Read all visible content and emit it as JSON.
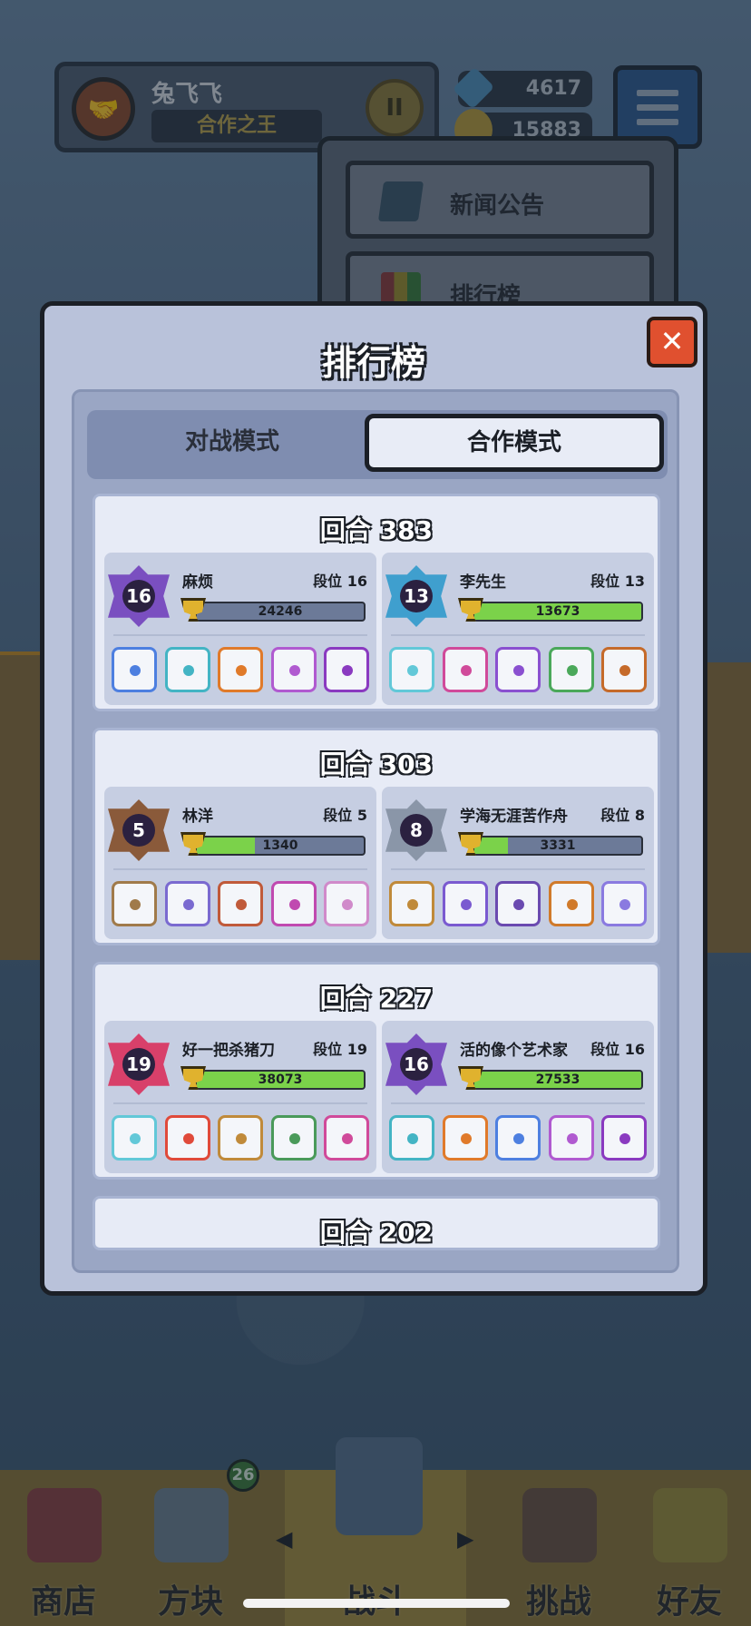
{
  "header": {
    "player_name": "兔飞飞",
    "player_title": "合作之王",
    "rank_badge_text": "II",
    "gems": "4617",
    "gold": "15883"
  },
  "dropdown": {
    "news_label": "新闻公告",
    "leaderboard_label": "排行榜"
  },
  "modal": {
    "title": "排行榜",
    "close_glyph": "✕",
    "tabs": {
      "battle": "对战模式",
      "coop": "合作模式"
    },
    "matches": [
      {
        "round": "回合 383",
        "players": [
          {
            "name": "麻烦",
            "tier_label": "段位 16",
            "badge": "16",
            "trophies": "24246",
            "progress": 0.0,
            "badge_color": "#7a4fc0",
            "dice_colors": [
              "#4d7fe0",
              "#43b4c4",
              "#e07a2a",
              "#b05ad0",
              "#8a3ac0"
            ]
          },
          {
            "name": "李先生",
            "tier_label": "段位 13",
            "badge": "13",
            "trophies": "13673",
            "progress": 1.0,
            "badge_color": "#3f9fce",
            "dice_colors": [
              "#62c8d8",
              "#d04a9a",
              "#8a50d0",
              "#4aa85a",
              "#c56a2a"
            ]
          }
        ]
      },
      {
        "round": "回合 303",
        "players": [
          {
            "name": "林洋",
            "tier_label": "段位 5",
            "badge": "5",
            "trophies": "1340",
            "progress": 0.35,
            "badge_color": "#8a5a3a",
            "dice_colors": [
              "#a07a4a",
              "#7a6ad0",
              "#c05a3a",
              "#c04ab0",
              "#d08aca"
            ]
          },
          {
            "name": "学海无涯苦作舟",
            "tier_label": "段位 8",
            "badge": "8",
            "trophies": "3331",
            "progress": 0.2,
            "badge_color": "#8a96a8",
            "dice_colors": [
              "#c08a3a",
              "#7a5ad0",
              "#6a4ab0",
              "#d07a2a",
              "#8a7ae0"
            ]
          }
        ]
      },
      {
        "round": "回合 227",
        "players": [
          {
            "name": "好一把杀猪刀",
            "tier_label": "段位 19",
            "badge": "19",
            "trophies": "38073",
            "progress": 1.0,
            "badge_color": "#d8406a",
            "dice_colors": [
              "#62c8d8",
              "#e04a3a",
              "#c08a3a",
              "#4a9a5a",
              "#d04a9a"
            ]
          },
          {
            "name": "活的像个艺术家",
            "tier_label": "段位 16",
            "badge": "16",
            "trophies": "27533",
            "progress": 1.0,
            "badge_color": "#7a4fc0",
            "dice_colors": [
              "#43b4c4",
              "#e07a2a",
              "#4d7fe0",
              "#b05ad0",
              "#8a3ac0"
            ]
          }
        ]
      },
      {
        "round": "回合 202",
        "players": []
      }
    ]
  },
  "bottom_nav": {
    "shop": "商店",
    "blocks": "方块",
    "blocks_badge": "26",
    "battle": "战斗",
    "challenge": "挑战",
    "friends": "好友",
    "prev_arrow": "◀",
    "next_arrow": "▶"
  }
}
